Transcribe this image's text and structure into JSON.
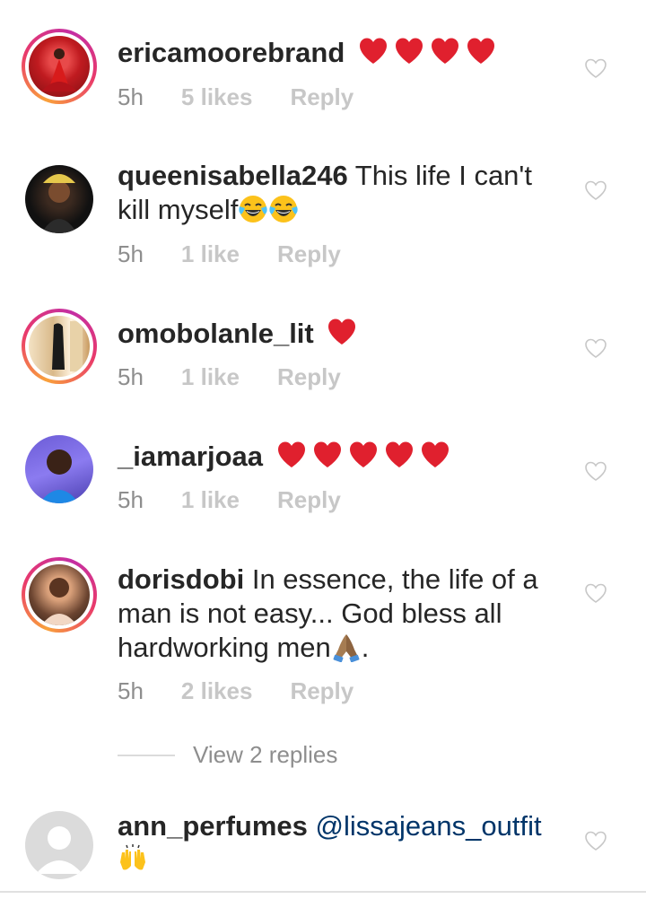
{
  "comments": [
    {
      "username": "ericamoorebrand",
      "text": "",
      "hearts": 4,
      "time": "5h",
      "likes": "5 likes",
      "reply": "Reply"
    },
    {
      "username": "queenisabella246",
      "text": " This life I can't kill myself",
      "trailing_emoji": "face-with-tears-of-joy x2",
      "time": "5h",
      "likes": "1 like",
      "reply": "Reply"
    },
    {
      "username": "omobolanle_lit",
      "text": "",
      "hearts": 1,
      "time": "5h",
      "likes": "1 like",
      "reply": "Reply"
    },
    {
      "username": "_iamarjoaa",
      "text": "",
      "hearts": 5,
      "time": "5h",
      "likes": "1 like",
      "reply": "Reply"
    },
    {
      "username": "dorisdobi",
      "text": " In essence, the life of a man is not easy... God bless all hardworking men",
      "trailing_emoji": "folded-hands",
      "text_after_emoji": ".",
      "time": "5h",
      "likes": "2 likes",
      "reply": "Reply"
    },
    {
      "username": "ann_perfumes",
      "text": " ",
      "mention": "@lissajeans_outfit",
      "trailing_emoji": "raising-hands"
    }
  ],
  "view_replies": "View 2 replies",
  "colors": {
    "username": "#262626",
    "meta": "#8e8e8e",
    "meta_bold": "#c7c7c7",
    "mention": "#003569",
    "heart_red": "#e0202e"
  },
  "icons": [
    "heart-outline-icon",
    "red-heart-icon",
    "face-with-tears-of-joy-icon",
    "folded-hands-icon",
    "raising-hands-icon",
    "default-avatar-icon"
  ]
}
